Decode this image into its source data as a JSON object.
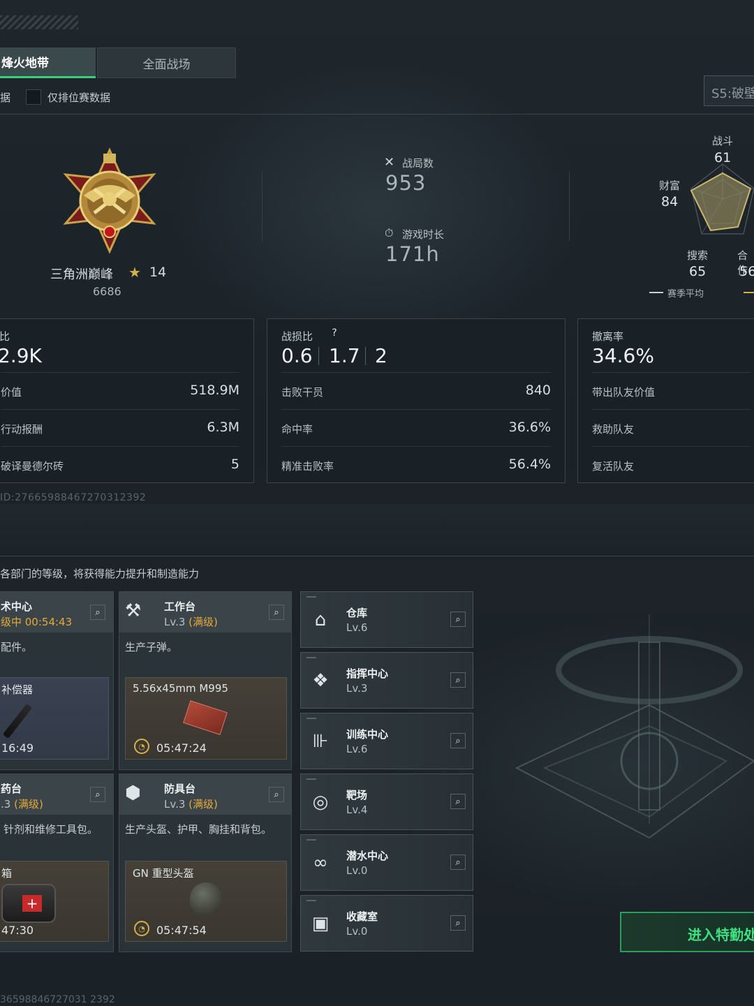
{
  "tabs": {
    "active": "烽火地带",
    "inactive": "全面战场"
  },
  "filter": {
    "left_stub": "据",
    "checkbox_label": "仅排位赛数据"
  },
  "season": {
    "label": "S5:破壁"
  },
  "rank": {
    "name": "三角洲巅峰",
    "stars": "14",
    "score": "6686"
  },
  "matches": {
    "label": "战局数",
    "value": "953"
  },
  "playtime": {
    "label": "游戏时长",
    "value": "171h"
  },
  "radar": {
    "combat": {
      "label": "战斗",
      "value": "61"
    },
    "wealth": {
      "label": "财富",
      "value": "84"
    },
    "search": {
      "label": "搜索",
      "value": "65"
    },
    "coop": {
      "label": "合作",
      "value": "56"
    },
    "legend": "赛季平均"
  },
  "panel_left": {
    "title": "比",
    "big": "2.9K",
    "rows": [
      {
        "k": "价值",
        "v": "518.9M"
      },
      {
        "k": "行动报酬",
        "v": "6.3M"
      },
      {
        "k": "破译曼德尔砖",
        "v": "5"
      }
    ]
  },
  "panel_mid": {
    "title": "战损比",
    "help": "?",
    "big1": "0.6",
    "big2": "1.7",
    "big3": "2",
    "rows": [
      {
        "k": "击败干员",
        "v": "840"
      },
      {
        "k": "命中率",
        "v": "36.6%"
      },
      {
        "k": "精准击败率",
        "v": "56.4%"
      }
    ]
  },
  "panel_right": {
    "title": "撤离率",
    "big": "34.6%",
    "rows": [
      {
        "k": "带出队友价值",
        "v": ""
      },
      {
        "k": "救助队友",
        "v": ""
      },
      {
        "k": "复活队友",
        "v": ""
      }
    ]
  },
  "player_id": "ID:2766598846727031 2392",
  "player_id_clean": "ID:27665988467270312392",
  "section_desc": "各部门的等级，将获得能力提升和制造能力",
  "cards": {
    "tech": {
      "name": "术中心",
      "timer": "级中 00:54:43",
      "desc": "配件。",
      "item": "补偿器",
      "time": "16:49"
    },
    "workbench": {
      "name": "工作台",
      "lv": "Lv.3",
      "lv_note": "(满级)",
      "desc": "生产子弹。",
      "item": "5.56x45mm M995",
      "time": "05:47:24"
    },
    "pharmacy": {
      "name": "药台",
      "lv": ".3",
      "lv_note": "(满级)",
      "desc": "针剂和维修工具包。",
      "item": "箱",
      "time": "47:30"
    },
    "armor": {
      "name": "防具台",
      "lv": "Lv.3",
      "lv_note": "(满级)",
      "desc": "生产头盔、护甲、胸挂和背包。",
      "item": "GN 重型头盔",
      "time": "05:47:54"
    }
  },
  "facilities": [
    {
      "name": "仓库",
      "lv": "Lv.6",
      "icon": "warehouse-icon"
    },
    {
      "name": "指挥中心",
      "lv": "Lv.3",
      "icon": "command-icon"
    },
    {
      "name": "训练中心",
      "lv": "Lv.6",
      "icon": "dumbbell-icon"
    },
    {
      "name": "靶场",
      "lv": "Lv.4",
      "icon": "target-icon"
    },
    {
      "name": "潜水中心",
      "lv": "Lv.0",
      "icon": "diving-mask-icon"
    },
    {
      "name": "收藏室",
      "lv": "Lv.0",
      "icon": "collection-icon"
    }
  ],
  "enter_button": "进入特勤处",
  "bottom_id": "36598846727031 2392"
}
